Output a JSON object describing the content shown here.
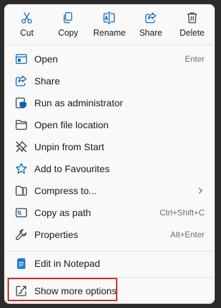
{
  "toolbar": {
    "cut_label": "Cut",
    "copy_label": "Copy",
    "rename_label": "Rename",
    "share_label": "Share",
    "delete_label": "Delete"
  },
  "menu": {
    "items": [
      {
        "label": "Open",
        "shortcut": "Enter",
        "icon": "open-window-icon"
      },
      {
        "label": "Share",
        "shortcut": "",
        "icon": "share-icon"
      },
      {
        "label": "Run as administrator",
        "shortcut": "",
        "icon": "shield-icon"
      },
      {
        "label": "Open file location",
        "shortcut": "",
        "icon": "folder-icon"
      },
      {
        "label": "Unpin from Start",
        "shortcut": "",
        "icon": "unpin-icon"
      },
      {
        "label": "Add to Favourites",
        "shortcut": "",
        "icon": "star-icon"
      },
      {
        "label": "Compress to...",
        "shortcut": "",
        "icon": "zip-folder-icon",
        "submenu": true
      },
      {
        "label": "Copy as path",
        "shortcut": "Ctrl+Shift+C",
        "icon": "path-icon"
      },
      {
        "label": "Properties",
        "shortcut": "Alt+Enter",
        "icon": "wrench-icon"
      },
      {
        "label": "Edit in Notepad",
        "shortcut": "",
        "icon": "notepad-icon"
      },
      {
        "label": "Show more options",
        "shortcut": "",
        "icon": "external-icon"
      }
    ]
  },
  "colors": {
    "accent": "#0067c0",
    "highlight_border": "#d9261c",
    "menu_background": "#f9f9f9",
    "separator": "#e3e3e3"
  }
}
